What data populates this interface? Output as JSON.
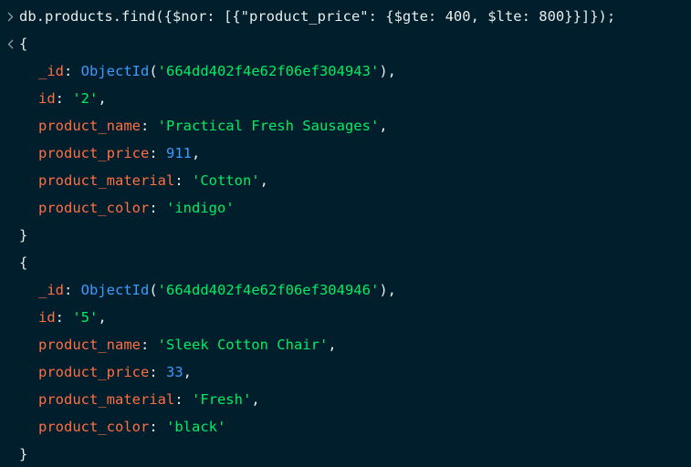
{
  "shell": {
    "command": "db.products.find({$nor: [{\"product_price\": {$gte: 400, $lte: 800}}]});",
    "input_icon": "chevron-right-icon",
    "output_icon": "chevron-left-icon",
    "open_brace": "{",
    "close_brace": "}",
    "results": [
      {
        "id_key": "_id",
        "id_fn": "ObjectId",
        "id_value": "'664dd402f4e62f06ef304943'",
        "fields": [
          {
            "key": "id",
            "value": "'2'",
            "kind": "str"
          },
          {
            "key": "product_name",
            "value": "'Practical Fresh Sausages'",
            "kind": "str"
          },
          {
            "key": "product_price",
            "value": "911",
            "kind": "num"
          },
          {
            "key": "product_material",
            "value": "'Cotton'",
            "kind": "str"
          },
          {
            "key": "product_color",
            "value": "'indigo'",
            "kind": "str"
          }
        ]
      },
      {
        "id_key": "_id",
        "id_fn": "ObjectId",
        "id_value": "'664dd402f4e62f06ef304946'",
        "fields": [
          {
            "key": "id",
            "value": "'5'",
            "kind": "str"
          },
          {
            "key": "product_name",
            "value": "'Sleek Cotton Chair'",
            "kind": "str"
          },
          {
            "key": "product_price",
            "value": "33",
            "kind": "num"
          },
          {
            "key": "product_material",
            "value": "'Fresh'",
            "kind": "str"
          },
          {
            "key": "product_color",
            "value": "'black'",
            "kind": "str"
          }
        ]
      }
    ]
  },
  "colors": {
    "background": "#001e2b",
    "key": "#ff6f44",
    "string": "#00ed64",
    "number": "#3d9bff",
    "text": "#e8edeb"
  }
}
